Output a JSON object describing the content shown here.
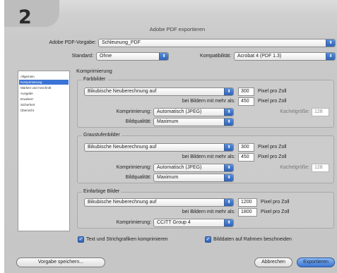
{
  "step_number": "2",
  "window": {
    "title": "Adobe PDF exportieren"
  },
  "preset": {
    "label": "Adobe PDF-Vorgabe:",
    "value": "Schleunung_PDF"
  },
  "standard": {
    "label": "Standard:",
    "value": "Ohne"
  },
  "compat": {
    "label": "Kompatibilität:",
    "value": "Acrobat 4 (PDF 1.3)"
  },
  "sidebar": {
    "items": [
      {
        "label": "Allgemein",
        "selected": false
      },
      {
        "label": "Komprimierung",
        "selected": true
      },
      {
        "label": "Marken und Anschnitt",
        "selected": false
      },
      {
        "label": "Ausgabe",
        "selected": false
      },
      {
        "label": "Erweitert",
        "selected": false
      },
      {
        "label": "Sicherheit",
        "selected": false
      },
      {
        "label": "Übersicht",
        "selected": false
      }
    ]
  },
  "main": {
    "section_title": "Komprimierung"
  },
  "farbbilder": {
    "title": "Farbbilder",
    "method": "Bikubische Neuberechnung auf",
    "ppi": "300",
    "ppi_unit": "Pixel pro Zoll",
    "above_label": "bei Bildern mit mehr als:",
    "above_value": "450",
    "above_unit": "Pixel pro Zoll",
    "compression_label": "Komprimierung:",
    "compression_value": "Automatisch (JPEG)",
    "tile_label": "Kachelgröße:",
    "tile_value": "128",
    "quality_label": "Bildqualität:",
    "quality_value": "Maximum"
  },
  "graustufen": {
    "title": "Graustufenbilder",
    "method": "Bikubische Neuberechnung auf",
    "ppi": "300",
    "ppi_unit": "Pixel pro Zoll",
    "above_label": "bei Bildern mit mehr als:",
    "above_value": "450",
    "above_unit": "Pixel pro Zoll",
    "compression_label": "Komprimierung:",
    "compression_value": "Automatisch (JPEG)",
    "tile_label": "Kachelgröße:",
    "tile_value": "128",
    "quality_label": "Bildqualität:",
    "quality_value": "Maximum"
  },
  "einfarbig": {
    "title": "Einfarbige Bilder",
    "method": "Bikubische Neuberechnung auf",
    "ppi": "1200",
    "ppi_unit": "Pixel pro Zoll",
    "above_label": "bei Bildern mit mehr als:",
    "above_value": "1800",
    "above_unit": "Pixel pro Zoll",
    "compression_label": "Komprimierung:",
    "compression_value": "CCITT Group 4"
  },
  "options": {
    "compress_text": "Text und Strichgrafiken komprimieren",
    "crop_images": "Bilddaten auf Rahmen beschneiden"
  },
  "buttons": {
    "save_preset": "Vorgabe speichern...",
    "cancel": "Abbrechen",
    "export": "Exportieren"
  },
  "icons": {
    "popup_arrows": "updown-arrows-icon",
    "checkmark": "checkmark-icon"
  },
  "colors": {
    "accent": "#3b73d6",
    "window_bg": "#c9c9c9"
  }
}
